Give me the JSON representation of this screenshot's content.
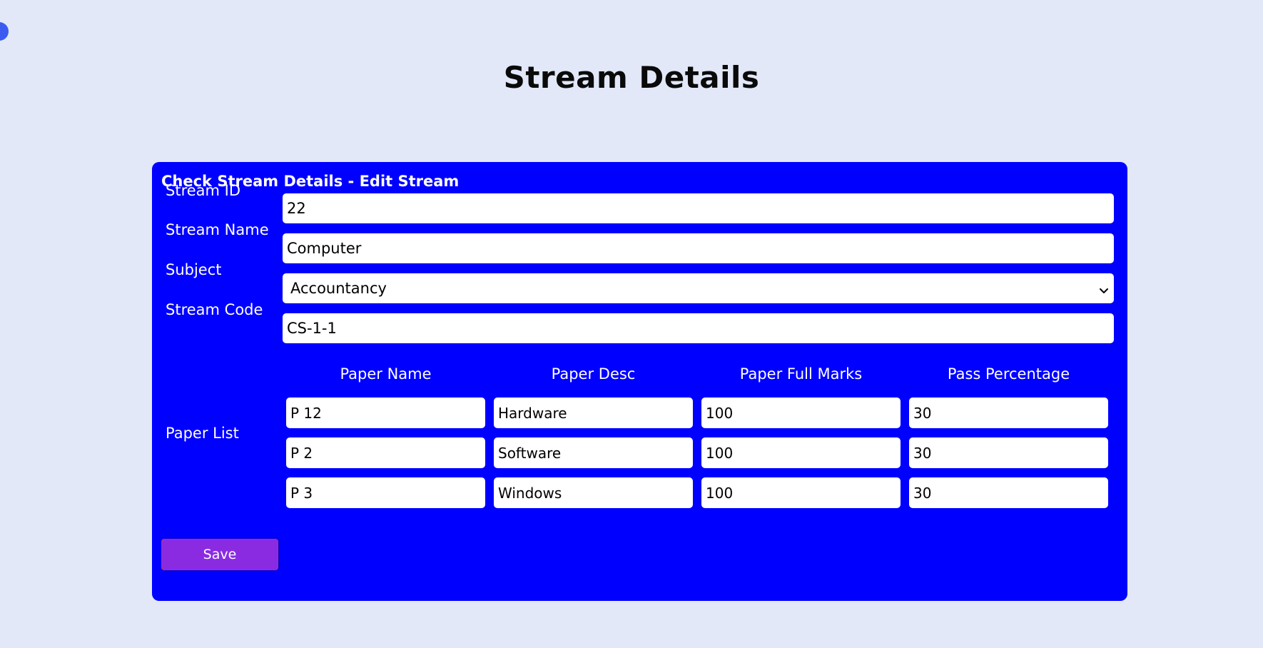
{
  "page": {
    "title": "Stream Details"
  },
  "form": {
    "heading": "Check Stream Details - Edit Stream",
    "stream_id": {
      "label": "Stream ID",
      "value": "22"
    },
    "stream_name": {
      "label": "Stream Name",
      "value": "Computer"
    },
    "subject": {
      "label": "Subject",
      "value": "Accountancy"
    },
    "stream_code": {
      "label": "Stream Code",
      "value": "CS-1-1"
    },
    "paper_list": {
      "label": "Paper List",
      "columns": [
        "Paper Name",
        "Paper Desc",
        "Paper Full Marks",
        "Pass Percentage"
      ],
      "rows": [
        [
          "P 12",
          "Hardware",
          "100",
          "30"
        ],
        [
          "P 2",
          "Software",
          "100",
          "30"
        ],
        [
          "P 3",
          "Windows",
          "100",
          "30"
        ]
      ]
    },
    "save_label": "Save"
  },
  "icons": {
    "corner": "circle-icon",
    "select": "chevron-down-icon"
  },
  "colors": {
    "background": "#e2e8f7",
    "card": "#0000ff",
    "save_button": "#8a2be2"
  }
}
